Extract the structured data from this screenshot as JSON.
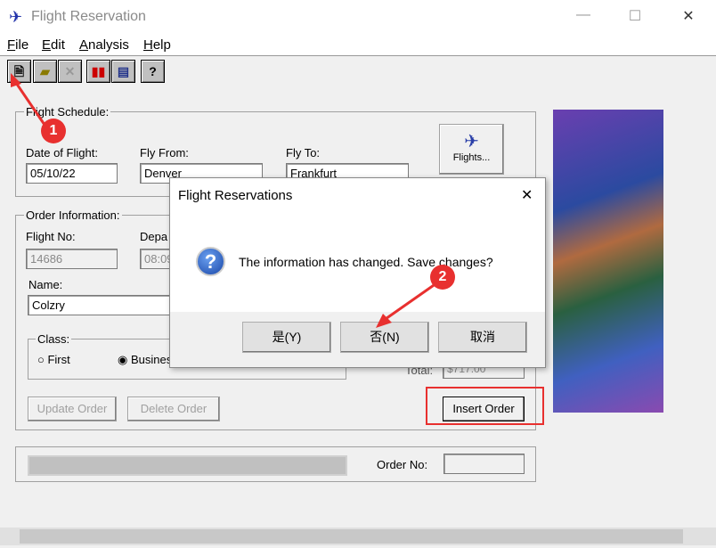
{
  "window": {
    "title": "Flight Reservation",
    "minimize": "—",
    "maximize": "☐",
    "close": "✕"
  },
  "menu": [
    {
      "label": "File",
      "key": "F",
      "rest": "ile"
    },
    {
      "label": "Edit",
      "key": "E",
      "rest": "dit"
    },
    {
      "label": "Analysis",
      "key": "A",
      "rest": "nalysis"
    },
    {
      "label": "Help",
      "key": "H",
      "rest": "elp"
    }
  ],
  "toolbar": {
    "new": "new-order-icon",
    "open": "open-folder-icon",
    "delete": "delete-icon",
    "graph": "bar-chart-icon",
    "report": "report-icon",
    "help": "?"
  },
  "schedule": {
    "legend": "Flight Schedule:",
    "date_label": "Date of Flight:",
    "date_value": "05/10/22",
    "from_label": "Fly From:",
    "from_value": "Denver",
    "to_label": "Fly To:",
    "to_value": "Frankfurt",
    "flights_button": "Flights..."
  },
  "order": {
    "legend": "Order Information:",
    "flight_no_label": "Flight No:",
    "flight_no_value": "14686",
    "departure_label": "Depa",
    "departure_value": "08:09",
    "name_label": "Name:",
    "name_value": "Colzry",
    "class_legend": "Class:",
    "class_first": "First",
    "class_business": "Busine",
    "class_selected": "Business",
    "total_label": "Total:",
    "total_value": "$717.00",
    "update_button": "Update Order",
    "delete_button": "Delete Order",
    "insert_button": "Insert Order"
  },
  "status": {
    "order_no_label": "Order No:",
    "order_no_value": ""
  },
  "dialog": {
    "title": "Flight Reservations",
    "message": "The information has changed. Save changes?",
    "yes": "是(Y)",
    "no": "否(N)",
    "cancel": "取消",
    "close": "✕"
  },
  "annotations": {
    "step1": "1",
    "step2": "2",
    "color": "#e8302f"
  }
}
